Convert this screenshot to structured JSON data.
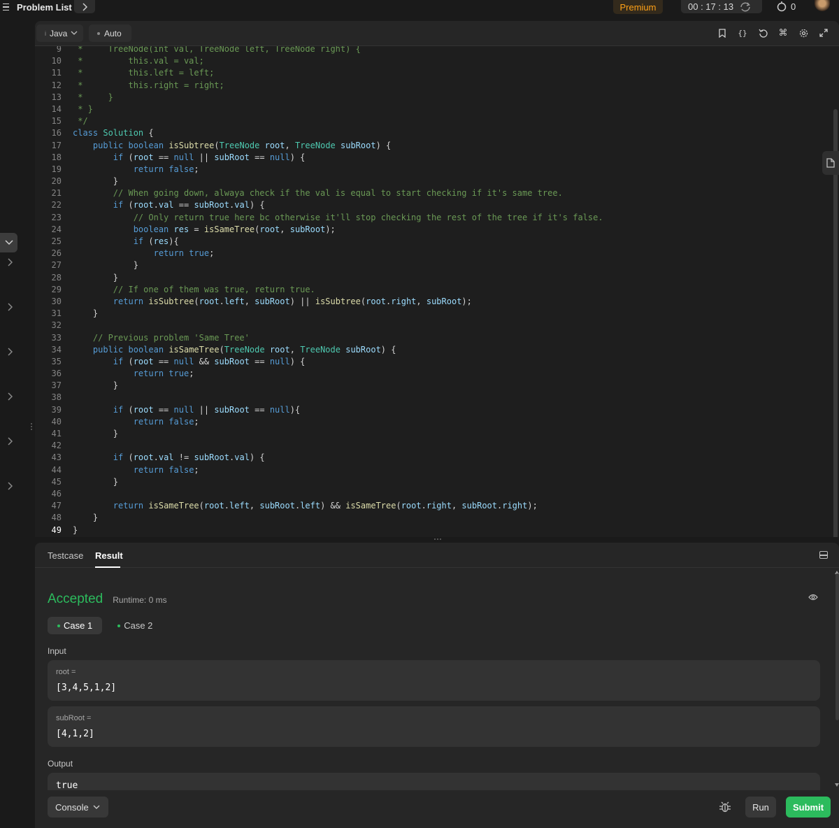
{
  "navbar": {
    "title": "Problem List",
    "premium_label": "Premium",
    "timer": "00 : 17 : 13",
    "streak_count": "0",
    "accent_color": "#ffa116"
  },
  "editor": {
    "language": "Java",
    "mode": "Auto",
    "toolbar_icons": [
      "bookmark-icon",
      "braces-icon",
      "reset-icon",
      "shortcut-icon",
      "settings-icon",
      "expand-icon"
    ],
    "lines": [
      {
        "n": "9",
        "code": " *     TreeNode(int val, TreeNode left, TreeNode right) {"
      },
      {
        "n": "10",
        "code": " *         this.val = val;"
      },
      {
        "n": "11",
        "code": " *         this.left = left;"
      },
      {
        "n": "12",
        "code": " *         this.right = right;"
      },
      {
        "n": "13",
        "code": " *     }"
      },
      {
        "n": "14",
        "code": " * }"
      },
      {
        "n": "15",
        "code": " */"
      },
      {
        "n": "16",
        "code": "class Solution {"
      },
      {
        "n": "17",
        "code": "    public boolean isSubtree(TreeNode root, TreeNode subRoot) {"
      },
      {
        "n": "18",
        "code": "        if (root == null || subRoot == null) {"
      },
      {
        "n": "19",
        "code": "            return false;"
      },
      {
        "n": "20",
        "code": "        }"
      },
      {
        "n": "21",
        "code": "        // When going down, alwaya check if the val is equal to start checking if it's same tree."
      },
      {
        "n": "22",
        "code": "        if (root.val == subRoot.val) {"
      },
      {
        "n": "23",
        "code": "            // Only return true here bc otherwise it'll stop checking the rest of the tree if it's false."
      },
      {
        "n": "24",
        "code": "            boolean res = isSameTree(root, subRoot);"
      },
      {
        "n": "25",
        "code": "            if (res){"
      },
      {
        "n": "26",
        "code": "                return true;"
      },
      {
        "n": "27",
        "code": "            }"
      },
      {
        "n": "28",
        "code": "        }"
      },
      {
        "n": "29",
        "code": "        // If one of them was true, return true."
      },
      {
        "n": "30",
        "code": "        return isSubtree(root.left, subRoot) || isSubtree(root.right, subRoot);"
      },
      {
        "n": "31",
        "code": "    }"
      },
      {
        "n": "32",
        "code": ""
      },
      {
        "n": "33",
        "code": "    // Previous problem 'Same Tree'"
      },
      {
        "n": "34",
        "code": "    public boolean isSameTree(TreeNode root, TreeNode subRoot) {"
      },
      {
        "n": "35",
        "code": "        if (root == null && subRoot == null) {"
      },
      {
        "n": "36",
        "code": "            return true;"
      },
      {
        "n": "37",
        "code": "        }"
      },
      {
        "n": "38",
        "code": ""
      },
      {
        "n": "39",
        "code": "        if (root == null || subRoot == null){"
      },
      {
        "n": "40",
        "code": "            return false;"
      },
      {
        "n": "41",
        "code": "        }"
      },
      {
        "n": "42",
        "code": ""
      },
      {
        "n": "43",
        "code": "        if (root.val != subRoot.val) {"
      },
      {
        "n": "44",
        "code": "            return false;"
      },
      {
        "n": "45",
        "code": "        }"
      },
      {
        "n": "46",
        "code": ""
      },
      {
        "n": "47",
        "code": "        return isSameTree(root.left, subRoot.left) && isSameTree(root.right, subRoot.right);"
      },
      {
        "n": "48",
        "code": "    }"
      },
      {
        "n": "49",
        "code": "}"
      }
    ]
  },
  "result": {
    "tabs": [
      "Testcase",
      "Result"
    ],
    "active_tab": "Result",
    "status": "Accepted",
    "status_color": "#2cbb5d",
    "runtime": "Runtime: 0 ms",
    "cases": [
      "Case 1",
      "Case 2"
    ],
    "input_label": "Input",
    "inputs": [
      {
        "name": "root =",
        "value": "[3,4,5,1,2]"
      },
      {
        "name": "subRoot =",
        "value": "[4,1,2]"
      }
    ],
    "output_label": "Output",
    "output_value": "true"
  },
  "bottom": {
    "console_label": "Console",
    "run_label": "Run",
    "submit_label": "Submit"
  }
}
